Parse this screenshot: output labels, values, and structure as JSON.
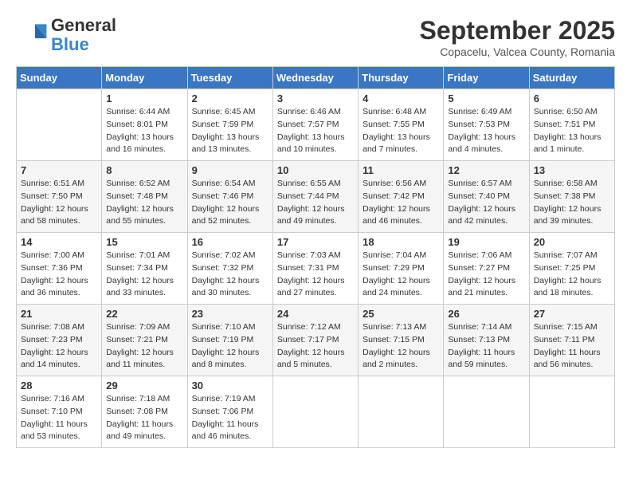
{
  "header": {
    "logo": {
      "line1": "General",
      "line2": "Blue"
    },
    "title": "September 2025",
    "subtitle": "Copacelu, Valcea County, Romania"
  },
  "days_of_week": [
    "Sunday",
    "Monday",
    "Tuesday",
    "Wednesday",
    "Thursday",
    "Friday",
    "Saturday"
  ],
  "weeks": [
    [
      {
        "day": "",
        "info": []
      },
      {
        "day": "1",
        "info": [
          "Sunrise: 6:44 AM",
          "Sunset: 8:01 PM",
          "Daylight: 13 hours",
          "and 16 minutes."
        ]
      },
      {
        "day": "2",
        "info": [
          "Sunrise: 6:45 AM",
          "Sunset: 7:59 PM",
          "Daylight: 13 hours",
          "and 13 minutes."
        ]
      },
      {
        "day": "3",
        "info": [
          "Sunrise: 6:46 AM",
          "Sunset: 7:57 PM",
          "Daylight: 13 hours",
          "and 10 minutes."
        ]
      },
      {
        "day": "4",
        "info": [
          "Sunrise: 6:48 AM",
          "Sunset: 7:55 PM",
          "Daylight: 13 hours",
          "and 7 minutes."
        ]
      },
      {
        "day": "5",
        "info": [
          "Sunrise: 6:49 AM",
          "Sunset: 7:53 PM",
          "Daylight: 13 hours",
          "and 4 minutes."
        ]
      },
      {
        "day": "6",
        "info": [
          "Sunrise: 6:50 AM",
          "Sunset: 7:51 PM",
          "Daylight: 13 hours",
          "and 1 minute."
        ]
      }
    ],
    [
      {
        "day": "7",
        "info": [
          "Sunrise: 6:51 AM",
          "Sunset: 7:50 PM",
          "Daylight: 12 hours",
          "and 58 minutes."
        ]
      },
      {
        "day": "8",
        "info": [
          "Sunrise: 6:52 AM",
          "Sunset: 7:48 PM",
          "Daylight: 12 hours",
          "and 55 minutes."
        ]
      },
      {
        "day": "9",
        "info": [
          "Sunrise: 6:54 AM",
          "Sunset: 7:46 PM",
          "Daylight: 12 hours",
          "and 52 minutes."
        ]
      },
      {
        "day": "10",
        "info": [
          "Sunrise: 6:55 AM",
          "Sunset: 7:44 PM",
          "Daylight: 12 hours",
          "and 49 minutes."
        ]
      },
      {
        "day": "11",
        "info": [
          "Sunrise: 6:56 AM",
          "Sunset: 7:42 PM",
          "Daylight: 12 hours",
          "and 46 minutes."
        ]
      },
      {
        "day": "12",
        "info": [
          "Sunrise: 6:57 AM",
          "Sunset: 7:40 PM",
          "Daylight: 12 hours",
          "and 42 minutes."
        ]
      },
      {
        "day": "13",
        "info": [
          "Sunrise: 6:58 AM",
          "Sunset: 7:38 PM",
          "Daylight: 12 hours",
          "and 39 minutes."
        ]
      }
    ],
    [
      {
        "day": "14",
        "info": [
          "Sunrise: 7:00 AM",
          "Sunset: 7:36 PM",
          "Daylight: 12 hours",
          "and 36 minutes."
        ]
      },
      {
        "day": "15",
        "info": [
          "Sunrise: 7:01 AM",
          "Sunset: 7:34 PM",
          "Daylight: 12 hours",
          "and 33 minutes."
        ]
      },
      {
        "day": "16",
        "info": [
          "Sunrise: 7:02 AM",
          "Sunset: 7:32 PM",
          "Daylight: 12 hours",
          "and 30 minutes."
        ]
      },
      {
        "day": "17",
        "info": [
          "Sunrise: 7:03 AM",
          "Sunset: 7:31 PM",
          "Daylight: 12 hours",
          "and 27 minutes."
        ]
      },
      {
        "day": "18",
        "info": [
          "Sunrise: 7:04 AM",
          "Sunset: 7:29 PM",
          "Daylight: 12 hours",
          "and 24 minutes."
        ]
      },
      {
        "day": "19",
        "info": [
          "Sunrise: 7:06 AM",
          "Sunset: 7:27 PM",
          "Daylight: 12 hours",
          "and 21 minutes."
        ]
      },
      {
        "day": "20",
        "info": [
          "Sunrise: 7:07 AM",
          "Sunset: 7:25 PM",
          "Daylight: 12 hours",
          "and 18 minutes."
        ]
      }
    ],
    [
      {
        "day": "21",
        "info": [
          "Sunrise: 7:08 AM",
          "Sunset: 7:23 PM",
          "Daylight: 12 hours",
          "and 14 minutes."
        ]
      },
      {
        "day": "22",
        "info": [
          "Sunrise: 7:09 AM",
          "Sunset: 7:21 PM",
          "Daylight: 12 hours",
          "and 11 minutes."
        ]
      },
      {
        "day": "23",
        "info": [
          "Sunrise: 7:10 AM",
          "Sunset: 7:19 PM",
          "Daylight: 12 hours",
          "and 8 minutes."
        ]
      },
      {
        "day": "24",
        "info": [
          "Sunrise: 7:12 AM",
          "Sunset: 7:17 PM",
          "Daylight: 12 hours",
          "and 5 minutes."
        ]
      },
      {
        "day": "25",
        "info": [
          "Sunrise: 7:13 AM",
          "Sunset: 7:15 PM",
          "Daylight: 12 hours",
          "and 2 minutes."
        ]
      },
      {
        "day": "26",
        "info": [
          "Sunrise: 7:14 AM",
          "Sunset: 7:13 PM",
          "Daylight: 11 hours",
          "and 59 minutes."
        ]
      },
      {
        "day": "27",
        "info": [
          "Sunrise: 7:15 AM",
          "Sunset: 7:11 PM",
          "Daylight: 11 hours",
          "and 56 minutes."
        ]
      }
    ],
    [
      {
        "day": "28",
        "info": [
          "Sunrise: 7:16 AM",
          "Sunset: 7:10 PM",
          "Daylight: 11 hours",
          "and 53 minutes."
        ]
      },
      {
        "day": "29",
        "info": [
          "Sunrise: 7:18 AM",
          "Sunset: 7:08 PM",
          "Daylight: 11 hours",
          "and 49 minutes."
        ]
      },
      {
        "day": "30",
        "info": [
          "Sunrise: 7:19 AM",
          "Sunset: 7:06 PM",
          "Daylight: 11 hours",
          "and 46 minutes."
        ]
      },
      {
        "day": "",
        "info": []
      },
      {
        "day": "",
        "info": []
      },
      {
        "day": "",
        "info": []
      },
      {
        "day": "",
        "info": []
      }
    ]
  ]
}
